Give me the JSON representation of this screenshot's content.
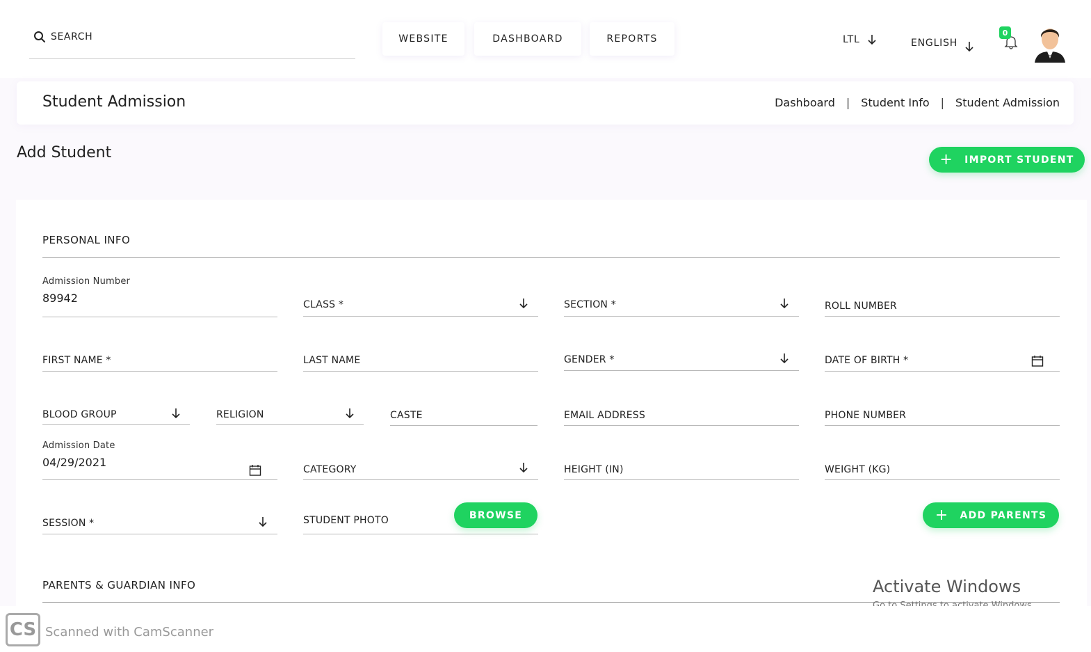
{
  "topbar": {
    "search_label": "SEARCH",
    "nav": [
      "WEBSITE",
      "DASHBOARD",
      "REPORTS"
    ],
    "school_selector": "LTL",
    "language_selector": "ENGLISH",
    "notification_count": "0"
  },
  "header": {
    "title": "Student Admission",
    "breadcrumb": [
      "Dashboard",
      "Student Info",
      "Student Admission"
    ],
    "breadcrumb_separator": "|"
  },
  "page": {
    "subtitle": "Add Student",
    "import_button": "IMPORT STUDENT"
  },
  "personal_info": {
    "title": "PERSONAL INFO",
    "admission_number_label": "Admission Number",
    "admission_number_value": "89942",
    "class_label": "CLASS *",
    "section_label": "SECTION *",
    "roll_number_label": "ROLL NUMBER",
    "first_name_label": "FIRST NAME *",
    "last_name_label": "LAST NAME",
    "gender_label": "GENDER *",
    "dob_label": "DATE OF BIRTH *",
    "blood_group_label": "BLOOD GROUP",
    "religion_label": "RELIGION",
    "caste_label": "CASTE",
    "email_label": "EMAIL ADDRESS",
    "phone_label": "PHONE NUMBER",
    "admission_date_label": "Admission Date",
    "admission_date_value": "04/29/2021",
    "category_label": "CATEGORY",
    "height_label": "HEIGHT (IN)",
    "weight_label": "WEIGHT (KG)",
    "session_label": "SESSION *",
    "photo_label": "STUDENT PHOTO",
    "browse_button": "BROWSE",
    "add_parents_button": "ADD PARENTS"
  },
  "parents_info": {
    "title": "PARENTS & GUARDIAN INFO"
  },
  "overlay": {
    "activate_title": "Activate Windows",
    "activate_sub": "Go to Settings to activate Windows.",
    "scanner_logo": "CS",
    "scanner_text": "Scanned with CamScanner"
  },
  "colors": {
    "accent_green": "#1fd360",
    "background": "#fbf9fd"
  }
}
